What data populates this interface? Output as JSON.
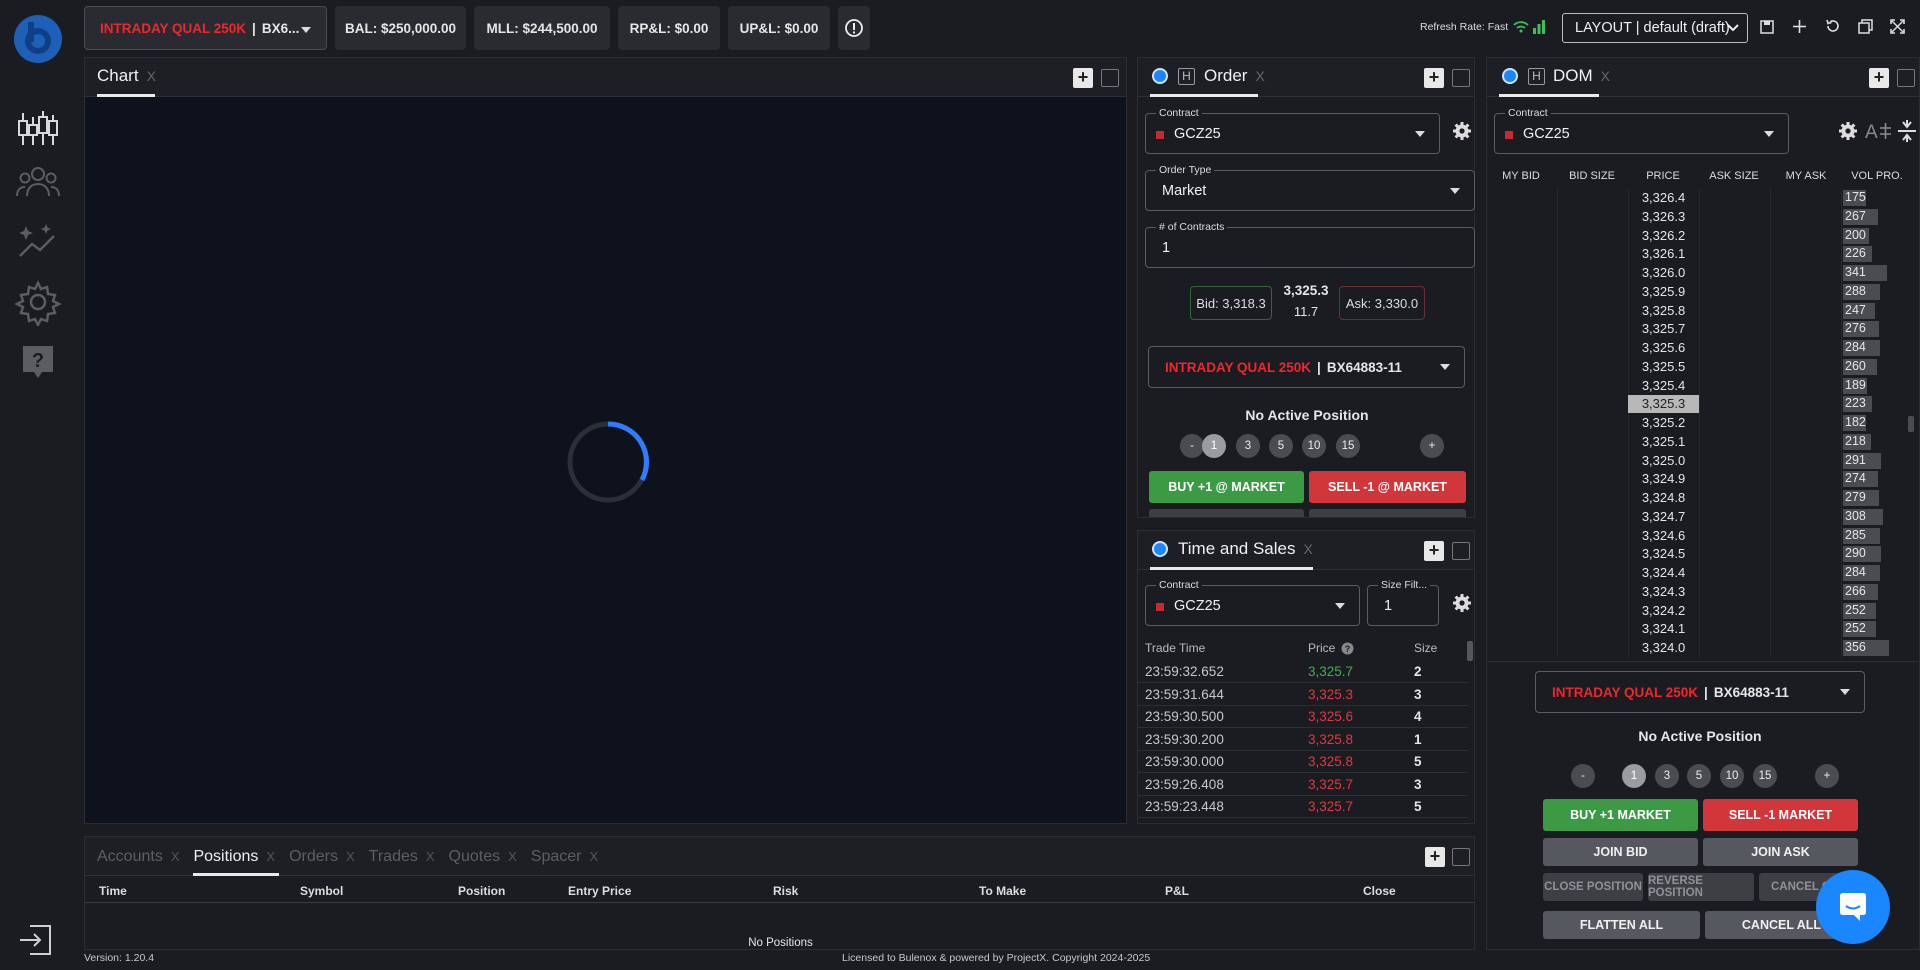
{
  "topbar": {
    "account_name": "INTRADAY QUAL 250K",
    "account_id_short": "BX6...",
    "bal": "BAL: $250,000.00",
    "mll": "MLL: $244,500.00",
    "rpl": "RP&L: $0.00",
    "upl": "UP&L: $0.00",
    "refresh_label": "Refresh Rate: Fast",
    "layout_select": "LAYOUT | default (draft)"
  },
  "chart_panel": {
    "tab": "Chart",
    "close": "X"
  },
  "order_panel": {
    "h": "H",
    "tab": "Order",
    "close": "X",
    "contract_label": "Contract",
    "contract": "GCZ25",
    "order_type_label": "Order Type",
    "order_type": "Market",
    "contracts_label": "# of Contracts",
    "contracts": "1",
    "bid": "Bid: 3,318.3",
    "last": "3,325.3",
    "spread": "11.7",
    "ask": "Ask: 3,330.0",
    "account_name": "INTRADAY QUAL 250K",
    "account_id": "BX64883-11",
    "position_status": "No Active Position",
    "minus": "-",
    "plus": "+",
    "qty_chips": [
      "1",
      "3",
      "5",
      "10",
      "15"
    ],
    "buy_label": "BUY +1 @ MARKET",
    "sell_label": "SELL -1 @ MARKET"
  },
  "ts_panel": {
    "tab": "Time and Sales",
    "close": "X",
    "contract_label": "Contract",
    "contract": "GCZ25",
    "size_filter_label": "Size Filt...",
    "size_filter": "1",
    "col_time": "Trade Time",
    "col_price": "Price",
    "col_size": "Size",
    "rows": [
      {
        "time": "23:59:32.652",
        "price": "3,325.7",
        "size": "2",
        "color": "#3fae4c"
      },
      {
        "time": "23:59:31.644",
        "price": "3,325.3",
        "size": "3",
        "color": "#e0393e"
      },
      {
        "time": "23:59:30.500",
        "price": "3,325.6",
        "size": "4",
        "color": "#e0393e"
      },
      {
        "time": "23:59:30.200",
        "price": "3,325.8",
        "size": "1",
        "color": "#e0393e"
      },
      {
        "time": "23:59:30.000",
        "price": "3,325.8",
        "size": "5",
        "color": "#e0393e"
      },
      {
        "time": "23:59:26.408",
        "price": "3,325.7",
        "size": "3",
        "color": "#e0393e"
      },
      {
        "time": "23:59:23.448",
        "price": "3,325.7",
        "size": "5",
        "color": "#e0393e"
      }
    ]
  },
  "dom_panel": {
    "h": "H",
    "tab": "DOM",
    "close": "X",
    "contract_label": "Contract",
    "contract": "GCZ25",
    "cols": [
      "MY BID",
      "BID SIZE",
      "PRICE",
      "ASK SIZE",
      "MY ASK",
      "VOL PRO."
    ],
    "rows": [
      {
        "price": "3,326.4",
        "vol": "175",
        "frac": 0.49
      },
      {
        "price": "3,326.3",
        "vol": "267",
        "frac": 0.75
      },
      {
        "price": "3,326.2",
        "vol": "200",
        "frac": 0.56
      },
      {
        "price": "3,326.1",
        "vol": "226",
        "frac": 0.63
      },
      {
        "price": "3,326.0",
        "vol": "341",
        "frac": 0.96
      },
      {
        "price": "3,325.9",
        "vol": "288",
        "frac": 0.81
      },
      {
        "price": "3,325.8",
        "vol": "247",
        "frac": 0.69
      },
      {
        "price": "3,325.7",
        "vol": "276",
        "frac": 0.78
      },
      {
        "price": "3,325.6",
        "vol": "284",
        "frac": 0.8
      },
      {
        "price": "3,325.5",
        "vol": "260",
        "frac": 0.73
      },
      {
        "price": "3,325.4",
        "vol": "189",
        "frac": 0.53
      },
      {
        "price": "3,325.3",
        "vol": "223",
        "frac": 0.63,
        "current": true
      },
      {
        "price": "3,325.2",
        "vol": "182",
        "frac": 0.51
      },
      {
        "price": "3,325.1",
        "vol": "218",
        "frac": 0.61
      },
      {
        "price": "3,325.0",
        "vol": "291",
        "frac": 0.82
      },
      {
        "price": "3,324.9",
        "vol": "274",
        "frac": 0.77
      },
      {
        "price": "3,324.8",
        "vol": "279",
        "frac": 0.78
      },
      {
        "price": "3,324.7",
        "vol": "308",
        "frac": 0.87
      },
      {
        "price": "3,324.6",
        "vol": "285",
        "frac": 0.8
      },
      {
        "price": "3,324.5",
        "vol": "290",
        "frac": 0.82
      },
      {
        "price": "3,324.4",
        "vol": "284",
        "frac": 0.8
      },
      {
        "price": "3,324.3",
        "vol": "266",
        "frac": 0.75
      },
      {
        "price": "3,324.2",
        "vol": "252",
        "frac": 0.71
      },
      {
        "price": "3,324.1",
        "vol": "252",
        "frac": 0.71
      },
      {
        "price": "3,324.0",
        "vol": "356",
        "frac": 1.0
      }
    ],
    "account_name": "INTRADAY QUAL 250K",
    "account_id": "BX64883-11",
    "position_status": "No Active Position",
    "minus": "-",
    "plus": "+",
    "qty_chips": [
      "1",
      "3",
      "5",
      "10",
      "15"
    ],
    "buy_label": "BUY +1 MARKET",
    "sell_label": "SELL -1 MARKET",
    "join_bid": "JOIN BID",
    "join_ask": "JOIN ASK",
    "close_position": "CLOSE POSITION",
    "reverse_position": "REVERSE POSITION",
    "cancel_oco": "CANCEL OC",
    "flatten_all": "FLATTEN ALL",
    "cancel_all": "CANCEL ALL"
  },
  "bottom_panel": {
    "tabs": [
      {
        "label": "Accounts",
        "active": false
      },
      {
        "label": "Positions",
        "active": true
      },
      {
        "label": "Orders",
        "active": false
      },
      {
        "label": "Trades",
        "active": false
      },
      {
        "label": "Quotes",
        "active": false
      },
      {
        "label": "Spacer",
        "active": false
      }
    ],
    "tab_close": "X",
    "columns": [
      "Time",
      "Symbol",
      "Position",
      "Entry Price",
      "Risk",
      "To Make",
      "P&L",
      "Close"
    ],
    "empty_text": "No Positions"
  },
  "footer": {
    "version": "Version: 1.20.4",
    "license": "Licensed to Bulenox & powered by ProjectX. Copyright 2024-2025"
  },
  "colors": {
    "accent_blue": "#1a86ff",
    "buy_green": "#3c9a45",
    "sell_red": "#d1363a",
    "brand_red": "#f0262d"
  }
}
